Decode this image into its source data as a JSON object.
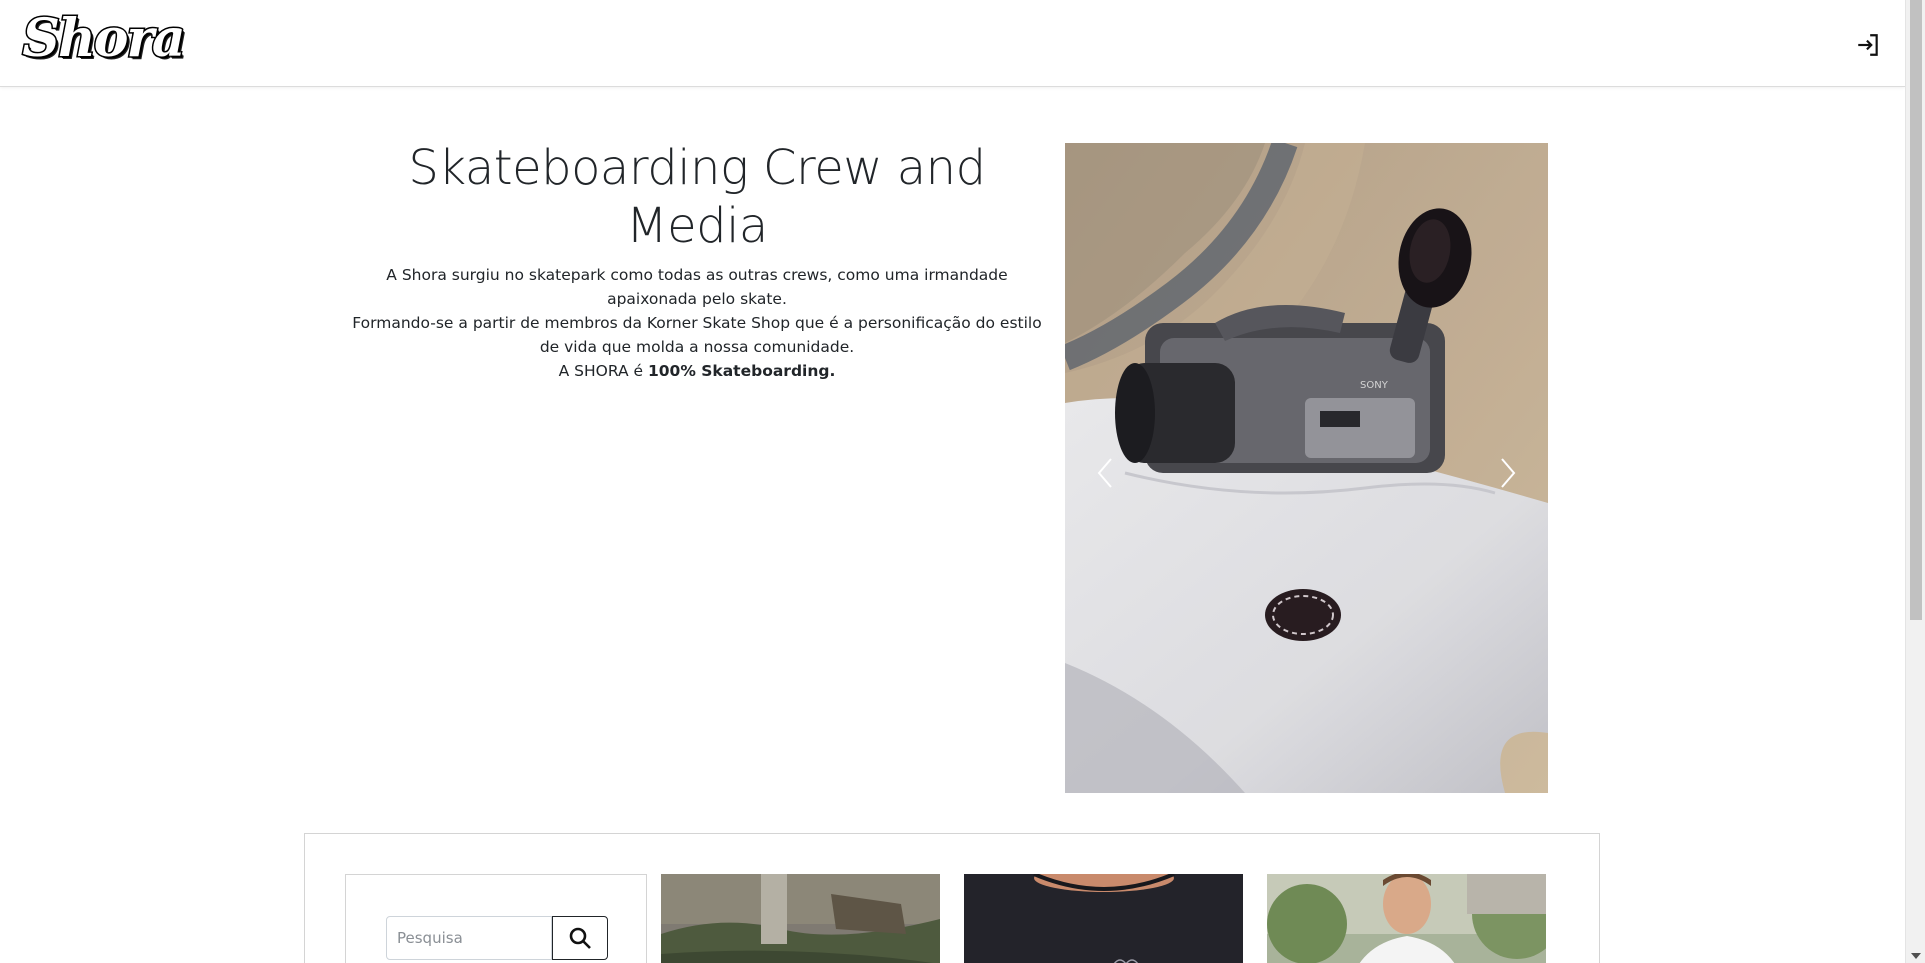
{
  "brand": {
    "logo_text": "Shora"
  },
  "header": {
    "login_icon": "login-icon"
  },
  "intro": {
    "title": "Skateboarding Crew and Media",
    "line1": "A Shora surgiu no skatepark como todas as outras crews, como uma irmandade apaixonada pelo skate.",
    "line2": "Formando-se a partir de membros da Korner Skate Shop que é a personificação do estilo de vida que molda a nossa comunidade.",
    "line3_prefix": "A SHORA é ",
    "line3_bold": "100% Skateboarding."
  },
  "carousel": {
    "prev_icon": "chevron-left-icon",
    "next_icon": "chevron-right-icon",
    "camera_brand": "SONY"
  },
  "search": {
    "placeholder": "Pesquisa",
    "button_icon": "search-icon"
  },
  "products": [
    {
      "name": "product-card-skatepark"
    },
    {
      "name": "product-card-tshirt-back"
    },
    {
      "name": "product-card-person-white-tee"
    }
  ]
}
